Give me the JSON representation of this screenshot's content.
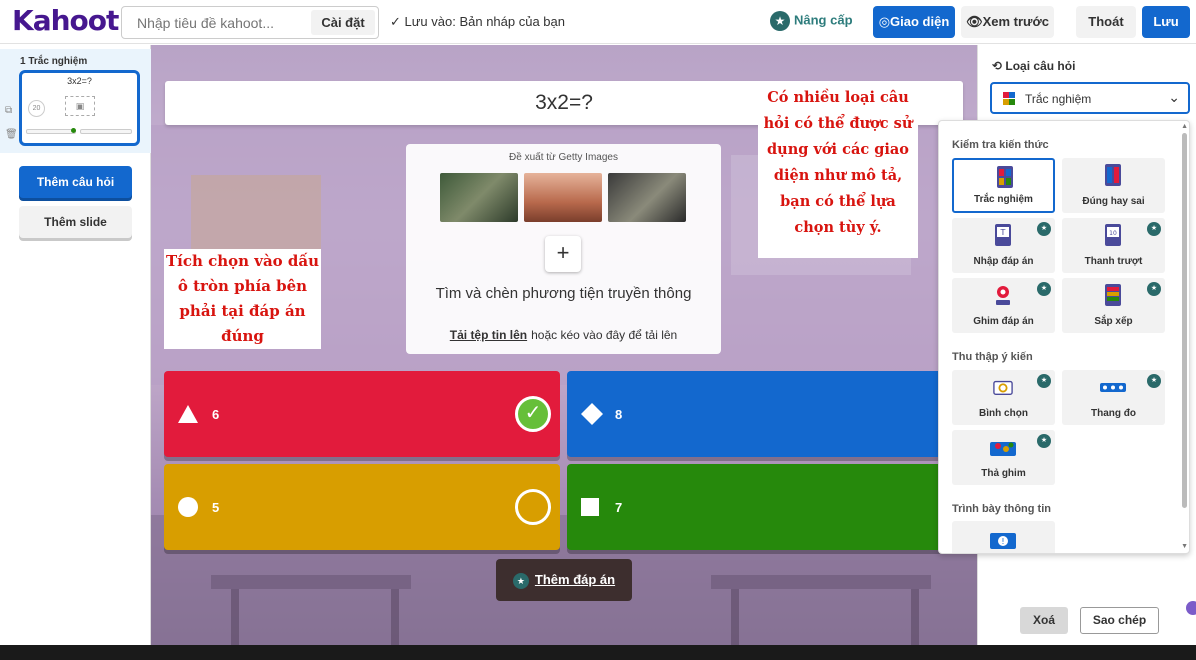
{
  "header": {
    "logo": "Kahoot!",
    "title_placeholder": "Nhập tiêu đề kahoot...",
    "settings_label": "Cài đặt",
    "save_status": "✓  Lưu vào: Bản nháp của bạn",
    "upgrade_label": "Nâng cấp",
    "theme_label": "Giao diện",
    "preview_label": "Xem trước",
    "exit_label": "Thoát",
    "save_label": "Lưu",
    "brand_color": "#46178f",
    "accent_color": "#1368ce"
  },
  "sidebar": {
    "slide_label": "1  Trắc nghiệm",
    "thumb_title": "3x2=?",
    "thumb_timer": "20",
    "add_question_label": "Thêm câu hỏi",
    "add_slide_label": "Thêm slide"
  },
  "editor": {
    "question": "3x2=?",
    "media": {
      "getty_label": "Đề xuất từ Getty Images",
      "find_label": "Tìm và chèn phương tiện truyền thông",
      "upload_link": "Tải tệp tin lên",
      "upload_rest": "hoặc kéo vào đây để tải lên"
    },
    "answers": [
      {
        "shape": "triangle-icon",
        "value": "6",
        "color": "#e21b3c",
        "correct": true
      },
      {
        "shape": "diamond-icon",
        "value": "8",
        "color": "#1368ce",
        "correct": false
      },
      {
        "shape": "circle-icon",
        "value": "5",
        "color": "#d89e00",
        "correct": false
      },
      {
        "shape": "square-icon",
        "value": "7",
        "color": "#26890c",
        "correct": false
      }
    ],
    "add_answer_label": "Thêm đáp án"
  },
  "notes": {
    "left": "Tích chọn vào dấu ô tròn phía bên phải tại đáp án đúng",
    "right": "Có nhiều loại câu hỏi có thể được sử dụng với các giao diện như mô tả, bạn có thể lựa chọn tùy ý."
  },
  "rightpanel": {
    "qtype_label": "Loại câu hỏi",
    "qtype_selected": "Trắc nghiệm",
    "delete_label": "Xoá",
    "copy_label": "Sao chép"
  },
  "dropdown": {
    "sections": [
      {
        "title": "Kiểm tra kiến thức",
        "items": [
          {
            "label": "Trắc nghiệm",
            "icon": "quiz-icon",
            "premium": false,
            "selected": true
          },
          {
            "label": "Đúng hay sai",
            "icon": "true-false-icon",
            "premium": false,
            "selected": false
          },
          {
            "label": "Nhập đáp án",
            "icon": "type-answer-icon",
            "premium": true,
            "selected": false
          },
          {
            "label": "Thanh trượt",
            "icon": "slider-icon",
            "premium": true,
            "selected": false
          },
          {
            "label": "Ghim đáp án",
            "icon": "pin-answer-icon",
            "premium": true,
            "selected": false
          },
          {
            "label": "Sắp xếp",
            "icon": "puzzle-icon",
            "premium": true,
            "selected": false
          }
        ]
      },
      {
        "title": "Thu thập ý kiến",
        "items": [
          {
            "label": "Bình chọn",
            "icon": "poll-icon",
            "premium": true,
            "selected": false
          },
          {
            "label": "Thang đo",
            "icon": "scale-icon",
            "premium": true,
            "selected": false
          },
          {
            "label": "Thả ghim",
            "icon": "drop-pin-icon",
            "premium": true,
            "selected": false
          }
        ]
      },
      {
        "title": "Trình bày thông tin",
        "items": [
          {
            "label": "",
            "icon": "info-slide-icon",
            "premium": false,
            "selected": false
          }
        ]
      }
    ]
  }
}
